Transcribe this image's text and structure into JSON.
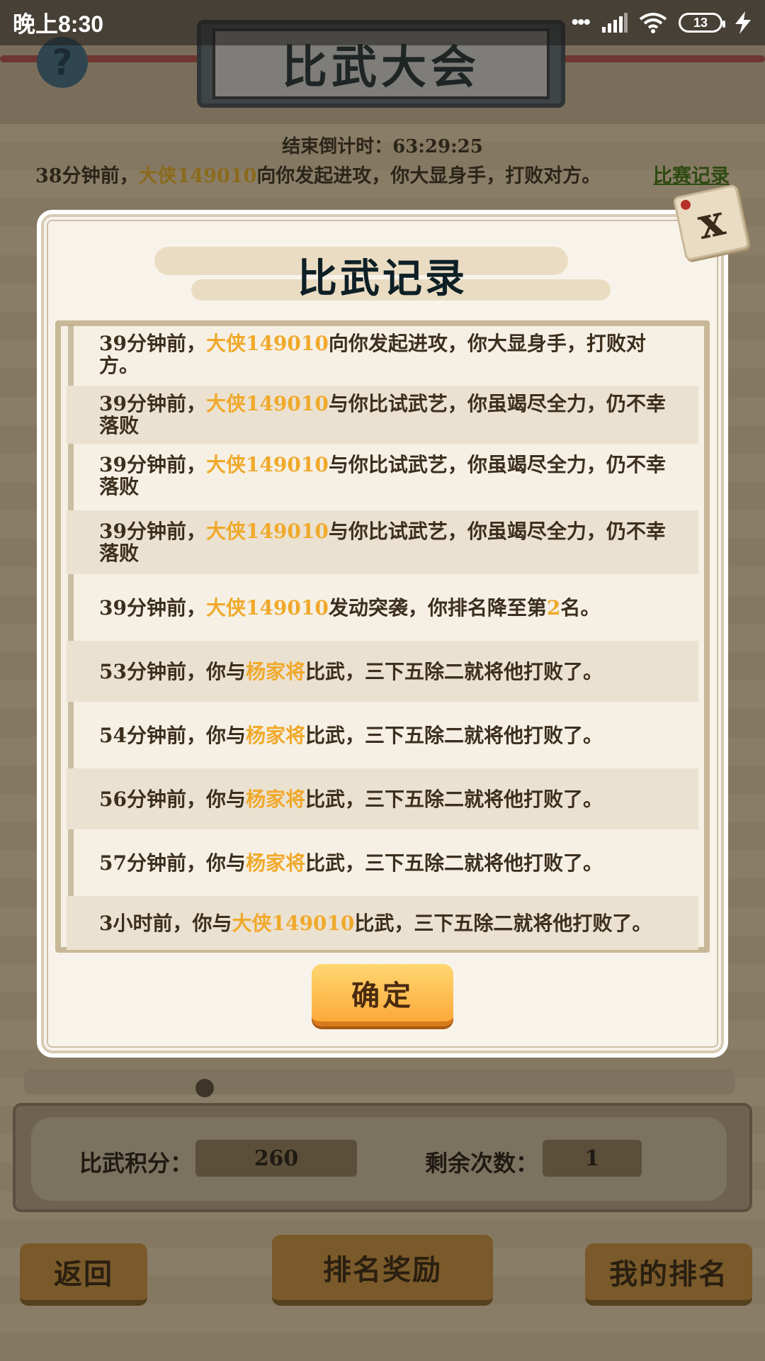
{
  "status_bar": {
    "time": "晚上8:30",
    "signal_dots": "•••",
    "battery": "13"
  },
  "background": {
    "title": "比武大会",
    "help_icon": "?",
    "countdown": "结束倒计时：63:29:25",
    "latest": {
      "prefix": "38分钟前，",
      "name": "大侠149010",
      "suffix": "向你发起进攻，你大显身手，打败对方。",
      "link": "比赛记录"
    },
    "score_label": "比武积分：",
    "score_value": "260",
    "remaining_label": "剩余次数：",
    "remaining_value": "1",
    "buttons": {
      "back": "返回",
      "rank_rewards": "排名奖励",
      "my_rank": "我的排名"
    }
  },
  "modal": {
    "title": "比武记录",
    "close_icon": "x",
    "confirm": "确定",
    "records": [
      {
        "pre": "39分钟前，",
        "name": "大侠149010",
        "post": "向你发起进攻，你大显身手，打败对方。"
      },
      {
        "pre": "39分钟前，",
        "name": "大侠149010",
        "post": "与你比试武艺，你虽竭尽全力，仍不幸落败"
      },
      {
        "pre": "39分钟前，",
        "name": "大侠149010",
        "post": "与你比试武艺，你虽竭尽全力，仍不幸落败"
      },
      {
        "pre": "39分钟前，",
        "name": "大侠149010",
        "post": "与你比试武艺，你虽竭尽全力，仍不幸落败"
      },
      {
        "pre": "39分钟前，",
        "name": "大侠149010",
        "post": "发动突袭，你排名降至第",
        "rank": "2",
        "tail": "名。"
      },
      {
        "pre": "53分钟前，你与",
        "name": "杨家将",
        "post": "比武，三下五除二就将他打败了。"
      },
      {
        "pre": "54分钟前，你与",
        "name": "杨家将",
        "post": "比武，三下五除二就将他打败了。"
      },
      {
        "pre": "56分钟前，你与",
        "name": "杨家将",
        "post": "比武，三下五除二就将他打败了。"
      },
      {
        "pre": "57分钟前，你与",
        "name": "杨家将",
        "post": "比武，三下五除二就将他打败了。"
      },
      {
        "pre": "3小时前，你与",
        "name": "大侠149010",
        "post": "比武，三下五除二就将他打败了。"
      }
    ]
  },
  "colors": {
    "highlight": "#f0a92b",
    "record_text": "#3c2f1e",
    "title": "#0e2026",
    "button": "#fcaa39"
  }
}
